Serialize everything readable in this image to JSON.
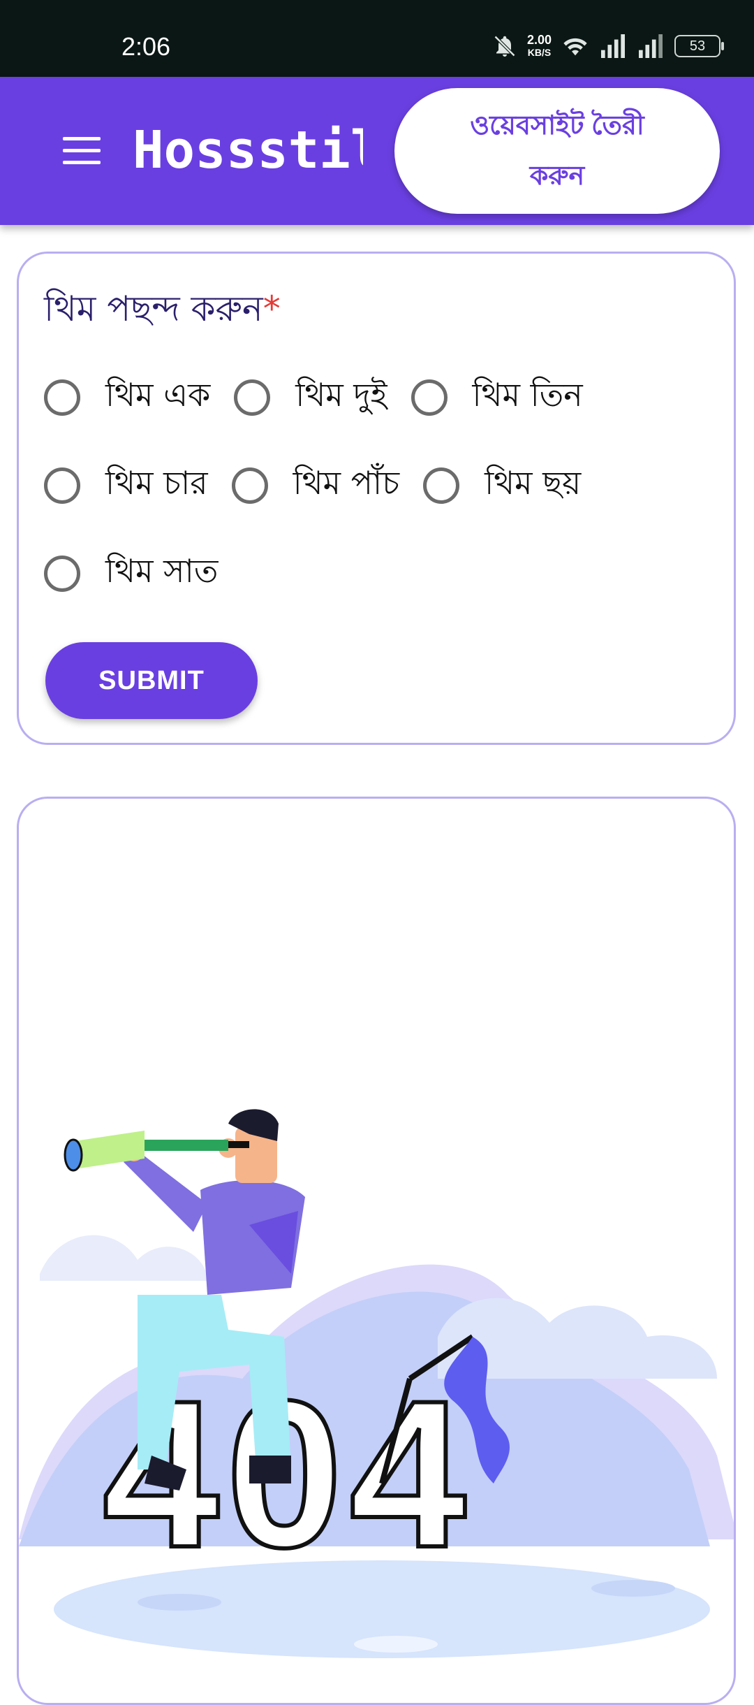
{
  "status": {
    "time": "2:06",
    "speed_value": "2.00",
    "speed_unit": "KB/S",
    "battery": "53"
  },
  "appbar": {
    "title": "Hossstil",
    "cta_label": "ওয়েবসাইট তৈরী করুন"
  },
  "form": {
    "title": "থিম পছন্দ করুন",
    "required_mark": "*",
    "options": [
      "থিম এক",
      "থিম দুই",
      "থিম তিন",
      "থিম চার",
      "থিম পাঁচ",
      "থিম ছয়",
      "থিম সাত"
    ],
    "submit_label": "SUBMIT"
  },
  "illustration": {
    "text": "404"
  },
  "colors": {
    "primary": "#6a3fe1",
    "card_border": "#b9aef1",
    "status_bg": "#0b1714"
  }
}
